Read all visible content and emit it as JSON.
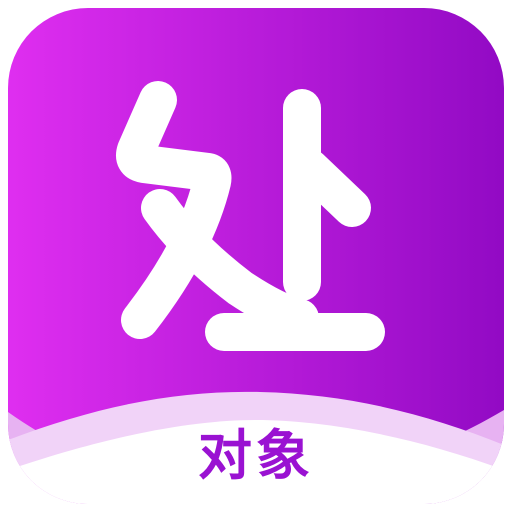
{
  "app_icon": {
    "glyph_name": "chu-character-glyph",
    "caption": "对象",
    "colors": {
      "gradient_start": "#df2ef0",
      "gradient_end": "#920ac4",
      "glyph": "#ffffff",
      "caption": "#9a12d2",
      "wave_light": "#f1d3f8",
      "wave_mid": "#e3a6ef"
    }
  }
}
